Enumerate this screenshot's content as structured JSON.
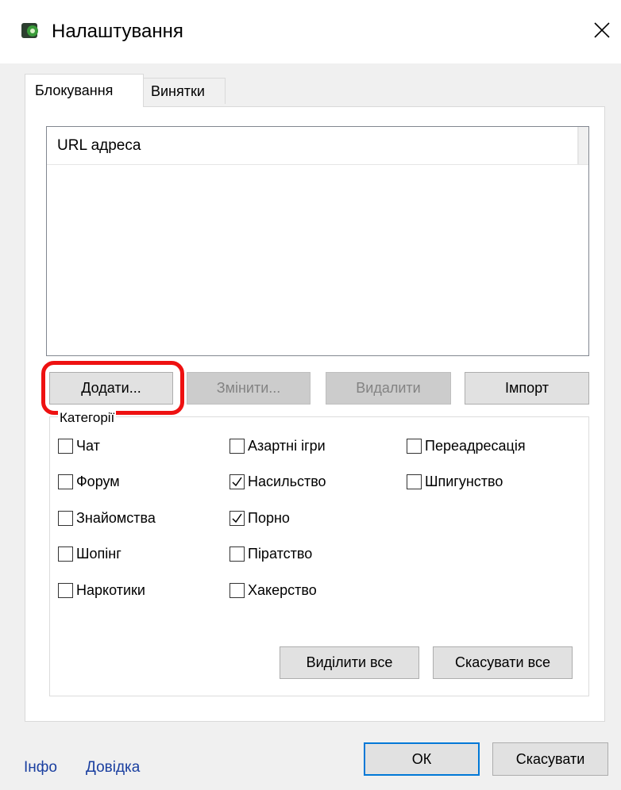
{
  "window": {
    "title": "Налаштування"
  },
  "tabs": [
    {
      "label": "Блокування",
      "active": true
    },
    {
      "label": "Винятки",
      "active": false
    }
  ],
  "url_list": {
    "column_header": "URL адреса",
    "rows": []
  },
  "list_buttons": {
    "add": "Додати...",
    "edit": "Змінити...",
    "delete": "Видалити",
    "import": "Імпорт"
  },
  "categories": {
    "label": "Категорії",
    "items": [
      {
        "label": "Чат",
        "checked": false
      },
      {
        "label": "Форум",
        "checked": false
      },
      {
        "label": "Знайомства",
        "checked": false
      },
      {
        "label": "Шопінг",
        "checked": false
      },
      {
        "label": "Наркотики",
        "checked": false
      },
      {
        "label": "Азартні ігри",
        "checked": false
      },
      {
        "label": "Насильство",
        "checked": true
      },
      {
        "label": "Порно",
        "checked": true
      },
      {
        "label": "Піратство",
        "checked": false
      },
      {
        "label": "Хакерство",
        "checked": false
      },
      {
        "label": "Переадресація",
        "checked": false
      },
      {
        "label": "Шпигунство",
        "checked": false
      }
    ],
    "select_all": "Виділити все",
    "deselect_all": "Скасувати все"
  },
  "footer": {
    "info_link": "Інфо",
    "help_link": "Довідка",
    "ok": "ОК",
    "cancel": "Скасувати"
  },
  "colors": {
    "accent": "#0078d7",
    "link": "#1a3fa0",
    "highlight": "#ee1111"
  }
}
